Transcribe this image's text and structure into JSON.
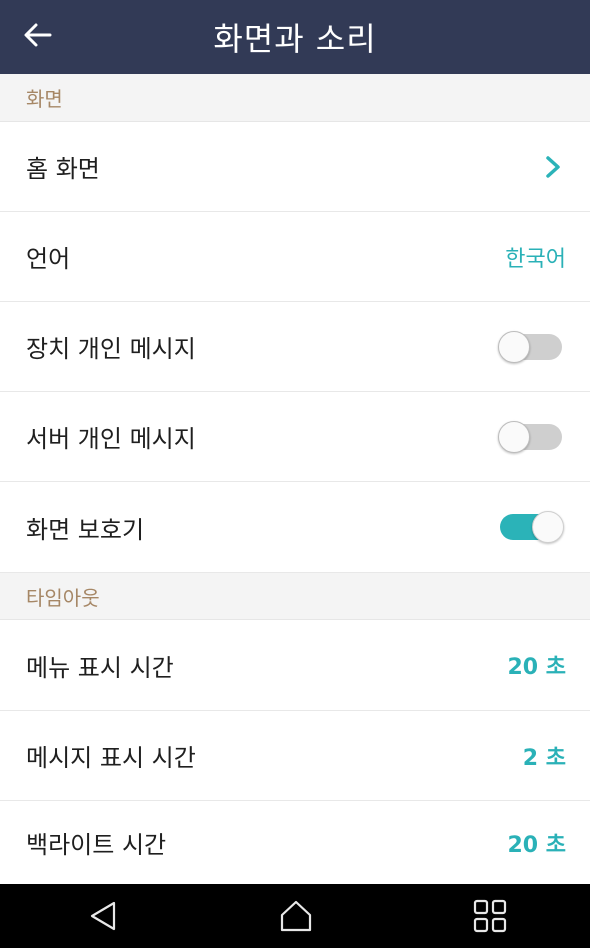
{
  "header": {
    "title": "화면과 소리",
    "back_icon": "arrow-left-icon"
  },
  "sections": {
    "display": {
      "header": "화면",
      "home_screen": {
        "label": "홈 화면",
        "icon": "chevron-right-icon"
      },
      "language": {
        "label": "언어",
        "value": "한국어"
      },
      "device_private_message": {
        "label": "장치 개인 메시지",
        "toggle": false
      },
      "server_private_message": {
        "label": "서버 개인 메시지",
        "toggle": false
      },
      "screensaver": {
        "label": "화면 보호기",
        "toggle": true
      }
    },
    "timeout": {
      "header": "타임아웃",
      "menu_display_time": {
        "label": "메뉴 표시 시간",
        "value": "20 초"
      },
      "message_display_time": {
        "label": "메시지 표시 시간",
        "value": "2 초"
      },
      "backlight_time": {
        "label": "백라이트 시간",
        "value": "20 초"
      }
    }
  },
  "colors": {
    "app_bar": "#323a56",
    "accent": "#2bb3b8",
    "section_header_text": "#a68766",
    "section_header_bg": "#f4f4f4",
    "nav_bar": "#000000"
  },
  "navbar": {
    "icons": [
      "back-triangle-icon",
      "home-icon",
      "recent-apps-icon"
    ]
  }
}
